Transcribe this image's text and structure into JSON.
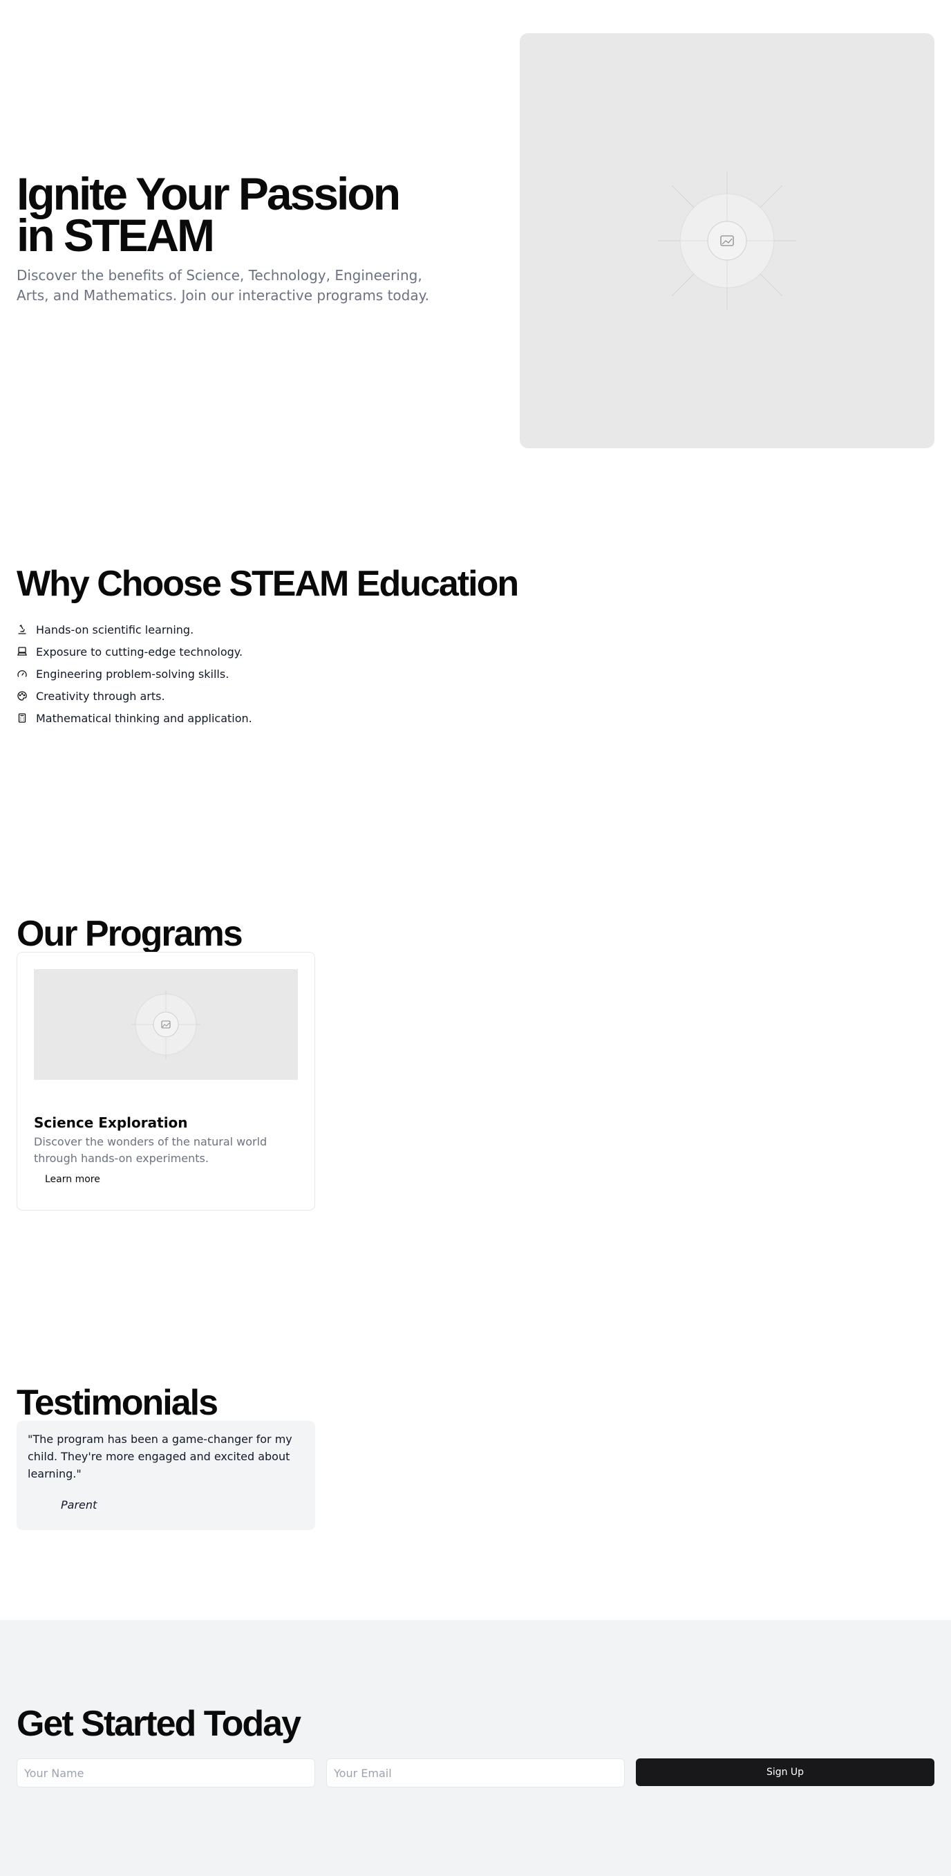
{
  "hero": {
    "title": "Ignite Your Passion in STEAM",
    "subtitle": "Discover the benefits of Science, Technology, Engineering, Arts, and Mathematics. Join our interactive programs today.",
    "image_icon": "image-placeholder-icon"
  },
  "why": {
    "title": "Why Choose STEAM Education",
    "items": [
      {
        "icon": "microscope-icon",
        "label": "Hands-on scientific learning."
      },
      {
        "icon": "computer-icon",
        "label": "Exposure to cutting-edge technology."
      },
      {
        "icon": "gauge-icon",
        "label": "Engineering problem-solving skills."
      },
      {
        "icon": "palette-icon",
        "label": "Creativity through arts."
      },
      {
        "icon": "calculator-icon",
        "label": "Mathematical thinking and application."
      }
    ]
  },
  "programs": {
    "title": "Our Programs",
    "cards": [
      {
        "title": "Science Exploration",
        "description": "Discover the wonders of the natural world through hands-on experiments.",
        "link_label": "Learn more"
      }
    ]
  },
  "testimonials": {
    "title": "Testimonials",
    "items": [
      {
        "quote": "\"The program has been a game-changer for my child. They're more engaged and excited about learning.\"",
        "author": "Parent"
      }
    ]
  },
  "cta": {
    "title": "Get Started Today",
    "name_placeholder": "Your Name",
    "email_placeholder": "Your Email",
    "button_label": "Sign Up"
  },
  "colors": {
    "text_primary": "#0a0a0a",
    "text_muted": "#6b7280",
    "placeholder_bg": "#e8e8e8",
    "cta_bg": "#f2f3f5",
    "button_bg": "#18181b"
  }
}
